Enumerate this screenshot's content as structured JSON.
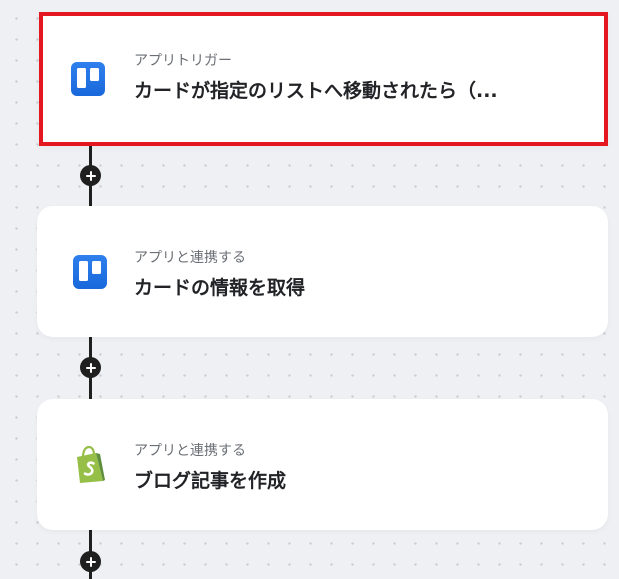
{
  "flow": {
    "steps": [
      {
        "label": "アプリトリガー",
        "title": "カードが指定のリストへ移動されたら（...",
        "app_icon": "trello-icon",
        "selected": true
      },
      {
        "label": "アプリと連携する",
        "title": "カードの情報を取得",
        "app_icon": "trello-icon",
        "selected": false
      },
      {
        "label": "アプリと連携する",
        "title": "ブログ記事を作成",
        "app_icon": "shopify-icon",
        "selected": false
      }
    ]
  },
  "colors": {
    "selection_border": "#e4161f",
    "trello_blue": "#1868db",
    "shopify_green": "#95bf47",
    "connector": "#1f1f1f"
  }
}
